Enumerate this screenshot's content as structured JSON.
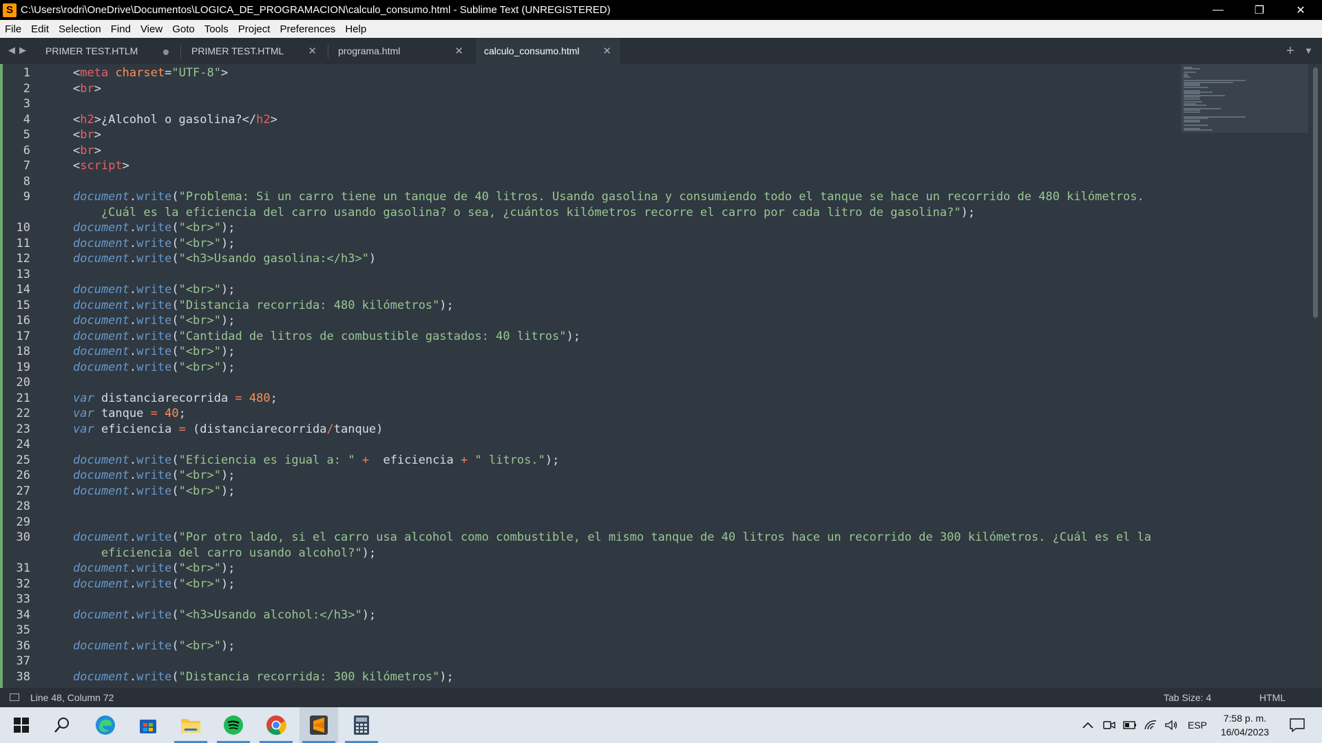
{
  "window": {
    "title": "C:\\Users\\rodri\\OneDrive\\Documentos\\LOGICA_DE_PROGRAMACION\\calculo_consumo.html - Sublime Text (UNREGISTERED)",
    "controls": {
      "minimize": "—",
      "maximize": "❐",
      "close": "✕"
    }
  },
  "menu": [
    "File",
    "Edit",
    "Selection",
    "Find",
    "View",
    "Goto",
    "Tools",
    "Project",
    "Preferences",
    "Help"
  ],
  "tabs": {
    "nav_left": "◀",
    "nav_right": "▶",
    "items": [
      {
        "label": "PRIMER TEST.HTLM",
        "modified": true,
        "active": false
      },
      {
        "label": "PRIMER TEST.HTML",
        "modified": false,
        "active": false
      },
      {
        "label": "programa.html",
        "modified": false,
        "active": false
      },
      {
        "label": "calculo_consumo.html",
        "modified": false,
        "active": true
      }
    ],
    "close_glyph": "✕",
    "new_tab": "+",
    "tab_menu": "▼"
  },
  "editor": {
    "lines": [
      [
        {
          "t": "<",
          "c": "br"
        },
        {
          "t": "meta",
          "c": "tag"
        },
        {
          "t": " charset",
          "c": "attr"
        },
        {
          "t": "=",
          "c": "br"
        },
        {
          "t": "\"UTF-8\"",
          "c": "str"
        },
        {
          "t": ">",
          "c": "br"
        }
      ],
      [
        {
          "t": "<",
          "c": "br"
        },
        {
          "t": "br",
          "c": "tag"
        },
        {
          "t": ">",
          "c": "br"
        }
      ],
      [],
      [
        {
          "t": "<",
          "c": "br"
        },
        {
          "t": "h2",
          "c": "tag"
        },
        {
          "t": ">¿Alcohol o gasolina?</",
          "c": "br"
        },
        {
          "t": "h2",
          "c": "tag"
        },
        {
          "t": ">",
          "c": "br"
        }
      ],
      [
        {
          "t": "<",
          "c": "br"
        },
        {
          "t": "br",
          "c": "tag"
        },
        {
          "t": ">",
          "c": "br"
        }
      ],
      [
        {
          "t": "<",
          "c": "br"
        },
        {
          "t": "br",
          "c": "tag"
        },
        {
          "t": ">",
          "c": "br"
        }
      ],
      [
        {
          "t": "<",
          "c": "br"
        },
        {
          "t": "script",
          "c": "tag"
        },
        {
          "t": ">",
          "c": "br"
        }
      ],
      [],
      [
        {
          "t": "document",
          "c": "kw"
        },
        {
          "t": ".",
          "c": "br"
        },
        {
          "t": "write",
          "c": "fn"
        },
        {
          "t": "(",
          "c": "br"
        },
        {
          "t": "\"Problema: Si un carro tiene un tanque de 40 litros. Usando gasolina y consumiendo todo el tanque se hace un recorrido de 480 kilómetros.",
          "c": "str"
        }
      ],
      [
        {
          "t": "    ¿Cuál es la eficiencia del carro usando gasolina? o sea, ¿cuántos kilómetros recorre el carro por cada litro de gasolina?\"",
          "c": "str"
        },
        {
          "t": ");",
          "c": "br"
        }
      ],
      [
        {
          "t": "document",
          "c": "kw"
        },
        {
          "t": ".",
          "c": "br"
        },
        {
          "t": "write",
          "c": "fn"
        },
        {
          "t": "(",
          "c": "br"
        },
        {
          "t": "\"<br>\"",
          "c": "str"
        },
        {
          "t": ");",
          "c": "br"
        }
      ],
      [
        {
          "t": "document",
          "c": "kw"
        },
        {
          "t": ".",
          "c": "br"
        },
        {
          "t": "write",
          "c": "fn"
        },
        {
          "t": "(",
          "c": "br"
        },
        {
          "t": "\"<br>\"",
          "c": "str"
        },
        {
          "t": ");",
          "c": "br"
        }
      ],
      [
        {
          "t": "document",
          "c": "kw"
        },
        {
          "t": ".",
          "c": "br"
        },
        {
          "t": "write",
          "c": "fn"
        },
        {
          "t": "(",
          "c": "br"
        },
        {
          "t": "\"<h3>Usando gasolina:</h3>\"",
          "c": "str"
        },
        {
          "t": ")",
          "c": "br"
        }
      ],
      [],
      [
        {
          "t": "document",
          "c": "kw"
        },
        {
          "t": ".",
          "c": "br"
        },
        {
          "t": "write",
          "c": "fn"
        },
        {
          "t": "(",
          "c": "br"
        },
        {
          "t": "\"<br>\"",
          "c": "str"
        },
        {
          "t": ");",
          "c": "br"
        }
      ],
      [
        {
          "t": "document",
          "c": "kw"
        },
        {
          "t": ".",
          "c": "br"
        },
        {
          "t": "write",
          "c": "fn"
        },
        {
          "t": "(",
          "c": "br"
        },
        {
          "t": "\"Distancia recorrida: 480 kilómetros\"",
          "c": "str"
        },
        {
          "t": ");",
          "c": "br"
        }
      ],
      [
        {
          "t": "document",
          "c": "kw"
        },
        {
          "t": ".",
          "c": "br"
        },
        {
          "t": "write",
          "c": "fn"
        },
        {
          "t": "(",
          "c": "br"
        },
        {
          "t": "\"<br>\"",
          "c": "str"
        },
        {
          "t": ");",
          "c": "br"
        }
      ],
      [
        {
          "t": "document",
          "c": "kw"
        },
        {
          "t": ".",
          "c": "br"
        },
        {
          "t": "write",
          "c": "fn"
        },
        {
          "t": "(",
          "c": "br"
        },
        {
          "t": "\"Cantidad de litros de combustible gastados: 40 litros\"",
          "c": "str"
        },
        {
          "t": ");",
          "c": "br"
        }
      ],
      [
        {
          "t": "document",
          "c": "kw"
        },
        {
          "t": ".",
          "c": "br"
        },
        {
          "t": "write",
          "c": "fn"
        },
        {
          "t": "(",
          "c": "br"
        },
        {
          "t": "\"<br>\"",
          "c": "str"
        },
        {
          "t": ");",
          "c": "br"
        }
      ],
      [
        {
          "t": "document",
          "c": "kw"
        },
        {
          "t": ".",
          "c": "br"
        },
        {
          "t": "write",
          "c": "fn"
        },
        {
          "t": "(",
          "c": "br"
        },
        {
          "t": "\"<br>\"",
          "c": "str"
        },
        {
          "t": ");",
          "c": "br"
        }
      ],
      [],
      [
        {
          "t": "var",
          "c": "kw"
        },
        {
          "t": " distanciarecorrida ",
          "c": "br"
        },
        {
          "t": "=",
          "c": "op"
        },
        {
          "t": " ",
          "c": "br"
        },
        {
          "t": "480",
          "c": "num"
        },
        {
          "t": ";",
          "c": "br"
        }
      ],
      [
        {
          "t": "var",
          "c": "kw"
        },
        {
          "t": " tanque ",
          "c": "br"
        },
        {
          "t": "=",
          "c": "op"
        },
        {
          "t": " ",
          "c": "br"
        },
        {
          "t": "40",
          "c": "num"
        },
        {
          "t": ";",
          "c": "br"
        }
      ],
      [
        {
          "t": "var",
          "c": "kw"
        },
        {
          "t": " eficiencia ",
          "c": "br"
        },
        {
          "t": "=",
          "c": "op"
        },
        {
          "t": " (distanciarecorrida",
          "c": "br"
        },
        {
          "t": "/",
          "c": "op"
        },
        {
          "t": "tanque)",
          "c": "br"
        }
      ],
      [],
      [
        {
          "t": "document",
          "c": "kw"
        },
        {
          "t": ".",
          "c": "br"
        },
        {
          "t": "write",
          "c": "fn"
        },
        {
          "t": "(",
          "c": "br"
        },
        {
          "t": "\"Eficiencia es igual a: \"",
          "c": "str"
        },
        {
          "t": " ",
          "c": "br"
        },
        {
          "t": "+",
          "c": "op"
        },
        {
          "t": "  eficiencia ",
          "c": "br"
        },
        {
          "t": "+",
          "c": "op"
        },
        {
          "t": " ",
          "c": "br"
        },
        {
          "t": "\" litros.\"",
          "c": "str"
        },
        {
          "t": ");",
          "c": "br"
        }
      ],
      [
        {
          "t": "document",
          "c": "kw"
        },
        {
          "t": ".",
          "c": "br"
        },
        {
          "t": "write",
          "c": "fn"
        },
        {
          "t": "(",
          "c": "br"
        },
        {
          "t": "\"<br>\"",
          "c": "str"
        },
        {
          "t": ");",
          "c": "br"
        }
      ],
      [
        {
          "t": "document",
          "c": "kw"
        },
        {
          "t": ".",
          "c": "br"
        },
        {
          "t": "write",
          "c": "fn"
        },
        {
          "t": "(",
          "c": "br"
        },
        {
          "t": "\"<br>\"",
          "c": "str"
        },
        {
          "t": ");",
          "c": "br"
        }
      ],
      [],
      [],
      [
        {
          "t": "document",
          "c": "kw"
        },
        {
          "t": ".",
          "c": "br"
        },
        {
          "t": "write",
          "c": "fn"
        },
        {
          "t": "(",
          "c": "br"
        },
        {
          "t": "\"Por otro lado, si el carro usa alcohol como combustible, el mismo tanque de 40 litros hace un recorrido de 300 kilómetros. ¿Cuál es el la",
          "c": "str"
        }
      ],
      [
        {
          "t": "    eficiencia del carro usando alcohol?\"",
          "c": "str"
        },
        {
          "t": ");",
          "c": "br"
        }
      ],
      [
        {
          "t": "document",
          "c": "kw"
        },
        {
          "t": ".",
          "c": "br"
        },
        {
          "t": "write",
          "c": "fn"
        },
        {
          "t": "(",
          "c": "br"
        },
        {
          "t": "\"<br>\"",
          "c": "str"
        },
        {
          "t": ");",
          "c": "br"
        }
      ],
      [
        {
          "t": "document",
          "c": "kw"
        },
        {
          "t": ".",
          "c": "br"
        },
        {
          "t": "write",
          "c": "fn"
        },
        {
          "t": "(",
          "c": "br"
        },
        {
          "t": "\"<br>\"",
          "c": "str"
        },
        {
          "t": ");",
          "c": "br"
        }
      ],
      [],
      [
        {
          "t": "document",
          "c": "kw"
        },
        {
          "t": ".",
          "c": "br"
        },
        {
          "t": "write",
          "c": "fn"
        },
        {
          "t": "(",
          "c": "br"
        },
        {
          "t": "\"<h3>Usando alcohol:</h3>\"",
          "c": "str"
        },
        {
          "t": ");",
          "c": "br"
        }
      ],
      [],
      [
        {
          "t": "document",
          "c": "kw"
        },
        {
          "t": ".",
          "c": "br"
        },
        {
          "t": "write",
          "c": "fn"
        },
        {
          "t": "(",
          "c": "br"
        },
        {
          "t": "\"<br>\"",
          "c": "str"
        },
        {
          "t": ");",
          "c": "br"
        }
      ],
      [],
      [
        {
          "t": "document",
          "c": "kw"
        },
        {
          "t": ".",
          "c": "br"
        },
        {
          "t": "write",
          "c": "fn"
        },
        {
          "t": "(",
          "c": "br"
        },
        {
          "t": "\"Distancia recorrida: 300 kilómetros\"",
          "c": "str"
        },
        {
          "t": ");",
          "c": "br"
        }
      ]
    ],
    "line_numbers": [
      "1",
      "2",
      "3",
      "4",
      "5",
      "6",
      "7",
      "8",
      "9",
      "",
      "10",
      "11",
      "12",
      "13",
      "14",
      "15",
      "16",
      "17",
      "18",
      "19",
      "20",
      "21",
      "22",
      "23",
      "24",
      "25",
      "26",
      "27",
      "28",
      "29",
      "30",
      "",
      "31",
      "32",
      "33",
      "34",
      "35",
      "36",
      "37",
      "38"
    ]
  },
  "status": {
    "position": "Line 48, Column 72",
    "tab_size": "Tab Size: 4",
    "syntax": "HTML"
  },
  "taskbar": {
    "apps": [
      "start-icon",
      "search-icon",
      "edge-icon",
      "store-icon",
      "file-explorer-icon",
      "spotify-icon",
      "chrome-icon",
      "sublime-text-icon",
      "calculator-icon"
    ],
    "tray": {
      "chevron": "^",
      "language": "ESP",
      "time": "7:58 p. m.",
      "date": "16/04/2023"
    }
  },
  "colors": {
    "editor_bg": "#303841",
    "tag": "#ec5f67",
    "string": "#99c794",
    "keyword": "#6699cc",
    "number": "#f99157"
  }
}
